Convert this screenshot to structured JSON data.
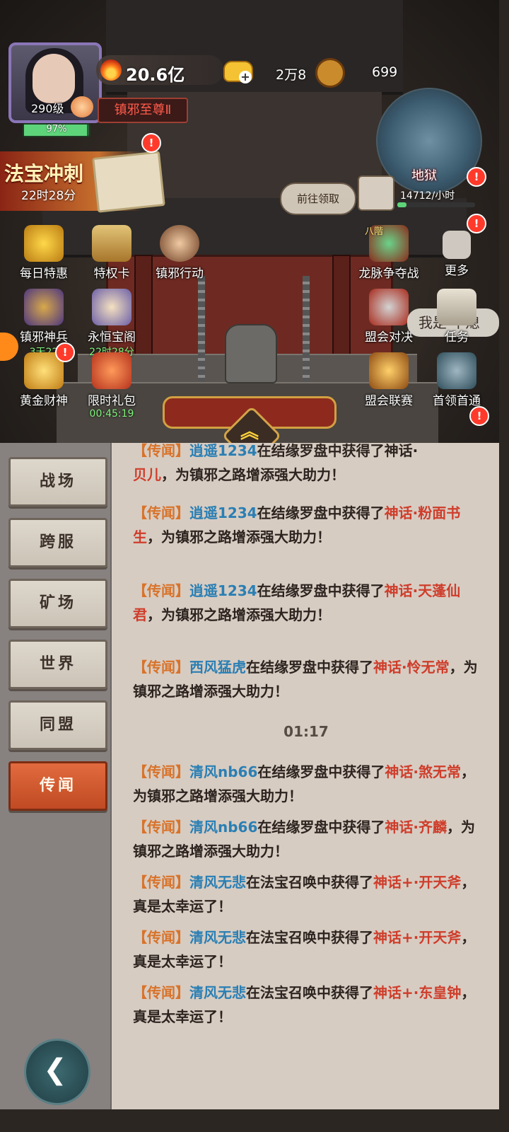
{
  "player": {
    "level": "290级",
    "hp_percent": "97%",
    "hp_fraction": 0.97,
    "power": "20.6亿",
    "title": "镇邪至尊Ⅱ"
  },
  "resources": {
    "gold": "2万8",
    "coins": "699"
  },
  "banner": {
    "title": "法宝冲刺",
    "timer": "22时28分"
  },
  "map": {
    "label": "地狱",
    "goto_label": "前往领取",
    "income": "14712/小时",
    "income_fraction": 0.12
  },
  "alert_mark": "!",
  "features_left": [
    {
      "label": "每日特惠",
      "icon": "gift-icon"
    },
    {
      "label": "特权卡",
      "icon": "card-icon"
    },
    {
      "label": "镇邪行动",
      "icon": "officer-icon"
    },
    {
      "label": "镇邪神兵",
      "sub": "3天22",
      "icon": "weapon-icon"
    },
    {
      "label": "永恒宝阁",
      "sub": "22时28分",
      "icon": "pavilion-icon"
    },
    {
      "label": "黄金财神",
      "icon": "fortune-god-icon"
    },
    {
      "label": "限时礼包",
      "sub": "00:45:19",
      "icon": "gift-box-icon"
    }
  ],
  "features_right": [
    {
      "label": "龙脉争夺战",
      "badge": "八階",
      "icon": "dragon-vein-icon"
    },
    {
      "label": "更多",
      "icon": "more-icon"
    },
    {
      "label": "盟会对决",
      "icon": "swords-icon"
    },
    {
      "label": "任务",
      "icon": "task-icon"
    },
    {
      "label": "盟会联赛",
      "icon": "league-icon"
    },
    {
      "label": "首领首通",
      "icon": "boss-icon"
    }
  ],
  "speech_bubble": "我是 不熄",
  "tabs": [
    {
      "label": "战场",
      "active": false
    },
    {
      "label": "跨服",
      "active": false
    },
    {
      "label": "矿场",
      "active": false
    },
    {
      "label": "世界",
      "active": false
    },
    {
      "label": "同盟",
      "active": false
    },
    {
      "label": "传闻",
      "active": true
    }
  ],
  "chat": {
    "partial_top": {
      "who": "逍遥1234",
      "rest": "在结缘罗盘中获得了神话·",
      "line2_item": "贝儿",
      "line2_tail": "，为镇邪之路增添强大助力！"
    },
    "messages": [
      {
        "tag": "【传闻】",
        "who": "逍遥1234",
        "verb": "在结缘罗盘中获得了",
        "item": "神话·粉面书生",
        "tail": "，为镇邪之路增添强大助力！"
      },
      {
        "tag": "【传闻】",
        "who": "逍遥1234",
        "verb": "在结缘罗盘中获得了",
        "item": "神话·天蓬仙君",
        "tail": "，为镇邪之路增添强大助力！"
      },
      {
        "tag": "【传闻】",
        "who": "西风猛虎",
        "verb": "在结缘罗盘中获得了",
        "item": "神话·怜无常",
        "tail": "，为镇邪之路增添强大助力！"
      }
    ],
    "timestamp": "01:17",
    "messages_after": [
      {
        "tag": "【传闻】",
        "who": "清风nb66",
        "verb": "在结缘罗盘中获得了",
        "item": "神话·煞无常",
        "tail": "，为镇邪之路增添强大助力！"
      },
      {
        "tag": "【传闻】",
        "who": "清风nb66",
        "verb": "在结缘罗盘中获得了",
        "item": "神话·齐麟",
        "tail": "，为镇邪之路增添强大助力！"
      },
      {
        "tag": "【传闻】",
        "who": "清风无悲",
        "verb": "在法宝召唤中获得了",
        "item": "神话+·开天斧",
        "tail": "，真是太幸运了！"
      },
      {
        "tag": "【传闻】",
        "who": "清风无悲",
        "verb": "在法宝召唤中获得了",
        "item": "神话+·开天斧",
        "tail": "，真是太幸运了！"
      },
      {
        "tag": "【传闻】",
        "who": "清风无悲",
        "verb": "在法宝召唤中获得了",
        "item": "神话+·东皇钟",
        "tail": "，真是太幸运了！"
      }
    ]
  }
}
